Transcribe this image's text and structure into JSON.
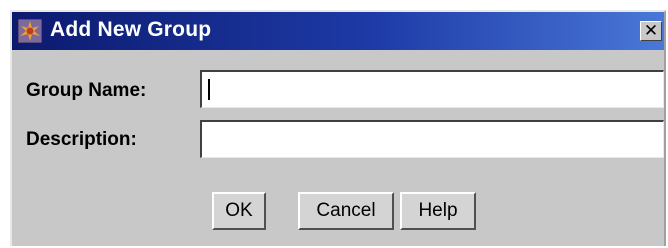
{
  "window": {
    "title": "Add New Group",
    "close_glyph": "✕",
    "icon": "app-icon"
  },
  "form": {
    "group_name_label": "Group Name:",
    "group_name_value": "",
    "description_label": "Description:",
    "description_value": ""
  },
  "buttons": {
    "ok": "OK",
    "cancel": "Cancel",
    "help": "Help"
  },
  "colors": {
    "titlebar_start": "#0c1a6e",
    "titlebar_end": "#4a78d8",
    "dialog_bg": "#c8c8c8"
  }
}
